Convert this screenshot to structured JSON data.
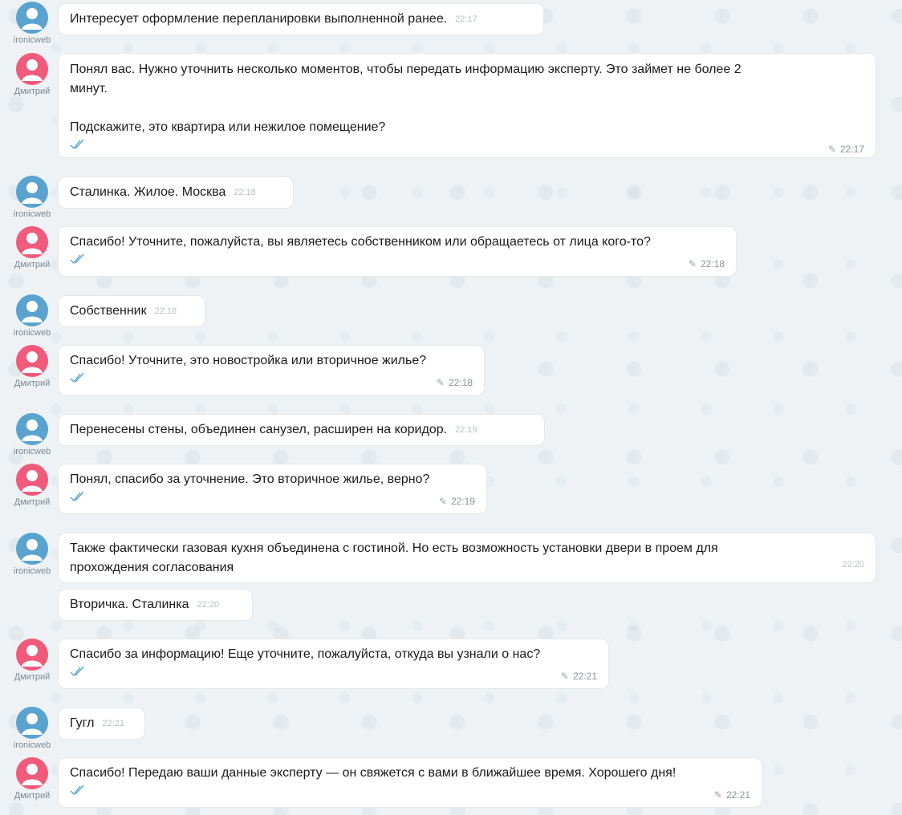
{
  "authors": {
    "client": "ironicweb",
    "operator": "Дмитрий"
  },
  "colors": {
    "client_avatar": "#5aa3cf",
    "operator_avatar": "#f05a7b",
    "check_marks": "#5aa3cf"
  },
  "messages": [
    {
      "author": "ironicweb",
      "text": "Интересует оформление перепланировки выполненной ранее.",
      "time": "22:17"
    },
    {
      "author": "Дмитрий",
      "text": "Понял вас. Нужно уточнить несколько моментов, чтобы передать информацию эксперту. Это займет не более 2\nминут.\n\nПодскажите, это квартира или нежилое помещение?",
      "time": "22:17",
      "edited": true,
      "read": true
    },
    {
      "author": "ironicweb",
      "text": "Сталинка. Жилое. Москва",
      "time": "22:18"
    },
    {
      "author": "Дмитрий",
      "text": "Спасибо! Уточните, пожалуйста, вы являетесь собственником или обращаетесь от лица кого-то?",
      "time": "22:18",
      "edited": true,
      "read": true
    },
    {
      "author": "ironicweb",
      "text": "Собственник",
      "time": "22:18"
    },
    {
      "author": "Дмитрий",
      "text": "Спасибо! Уточните, это новостройка или вторичное жилье?",
      "time": "22:18",
      "edited": true,
      "read": true
    },
    {
      "author": "ironicweb",
      "text": "Перенесены стены, объединен санузел, расширен на коридор.",
      "time": "22:19"
    },
    {
      "author": "Дмитрий",
      "text": "Понял, спасибо за уточнение. Это вторичное жилье, верно?",
      "time": "22:19",
      "edited": true,
      "read": true
    },
    {
      "author": "ironicweb",
      "text": "Также фактически газовая кухня объединена с гостиной. Но есть возможность установки двери в проем для\nпрохождения согласования",
      "time": "22:20"
    },
    {
      "author": "",
      "text": "Вторичка. Сталинка",
      "time": "22:20"
    },
    {
      "author": "Дмитрий",
      "text": "Спасибо за информацию! Еще уточните, пожалуйста, откуда вы узнали о нас?",
      "time": "22:21",
      "edited": true,
      "read": true
    },
    {
      "author": "ironicweb",
      "text": "Гугл",
      "time": "22:21"
    },
    {
      "author": "Дмитрий",
      "text": "Спасибо! Передаю ваши данные эксперту — он свяжется с вами в ближайшее время. Хорошего дня!",
      "time": "22:21",
      "edited": true,
      "read": true
    }
  ]
}
